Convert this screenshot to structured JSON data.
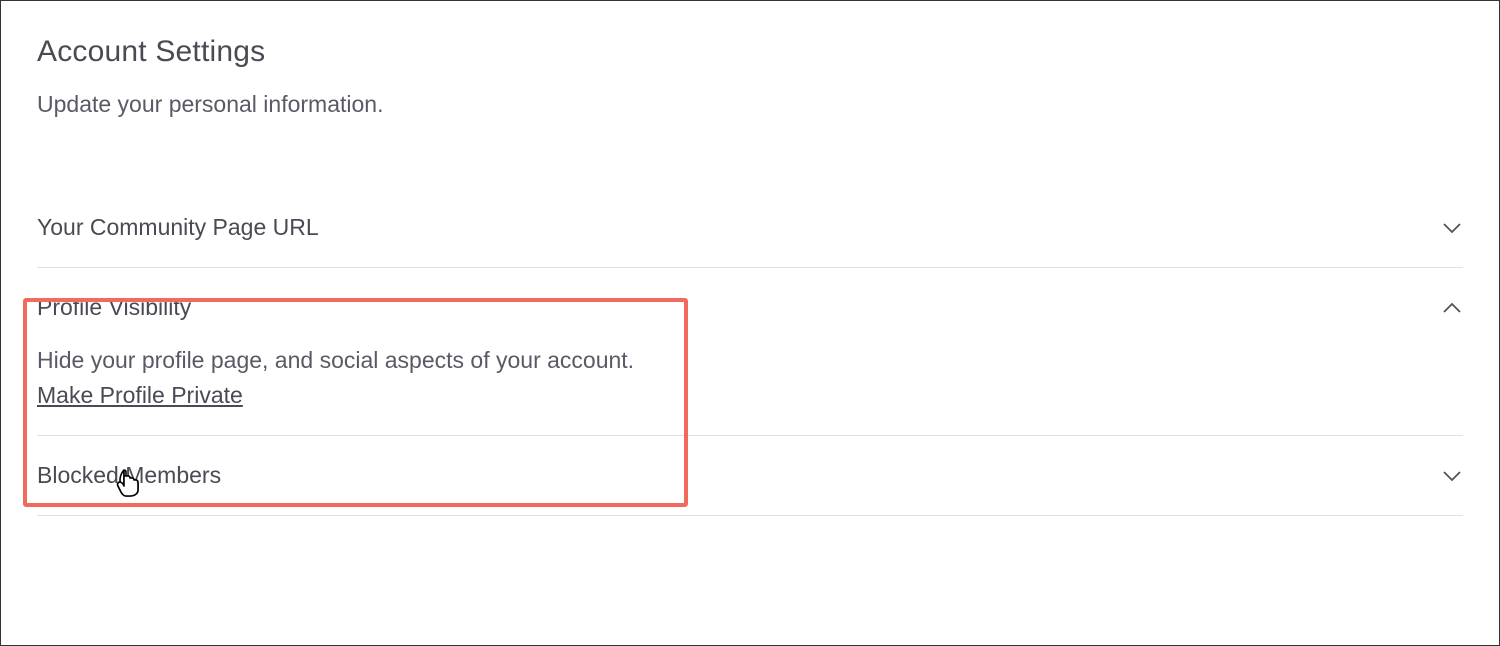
{
  "page": {
    "title": "Account Settings",
    "subtitle": "Update your personal information."
  },
  "sections": [
    {
      "label": "Your Community Page URL",
      "expanded": false
    },
    {
      "label": "Profile Visibility",
      "expanded": true,
      "description": "Hide your profile page, and social aspects of your account.",
      "action_label": "Make Profile Private"
    },
    {
      "label": "Blocked Members",
      "expanded": false
    }
  ]
}
